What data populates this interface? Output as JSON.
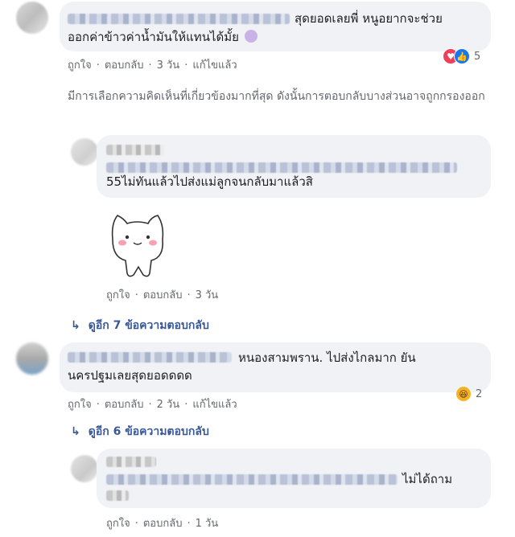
{
  "comments": [
    {
      "text_line1": "สุดยอดเลยพี่ หนูอยากจะช่วย",
      "text_line2": "ออกค่าข้าวค่าน้ำมันให้แทนได้มั้ย",
      "actions": {
        "like": "ถูกใจ",
        "reply": "ตอบกลับ",
        "time": "3 วัน",
        "edited": "แก้ไขแล้ว"
      },
      "reaction_count": "5",
      "notice": "มีการเลือกความคิดเห็นที่เกี่ยวข้องมากที่สุด ดังนั้นการตอบกลับบางส่วนอาจถูกกรองออก"
    },
    {
      "text": "55ไม่ทันแล้วไปส่งแม่ลูกจนกลับมาแล้วสิ",
      "actions": {
        "like": "ถูกใจ",
        "reply": "ตอบกลับ",
        "time": "3 วัน"
      },
      "more_replies": "ดูอีก 7 ข้อความตอบกลับ"
    },
    {
      "text_line1": "หนองสามพราน. ไปส่งไกลมาก ยัน",
      "text_line2": "นครปฐมเลยสุดยอดดดด",
      "actions": {
        "like": "ถูกใจ",
        "reply": "ตอบกลับ",
        "time": "2 วัน",
        "edited": "แก้ไขแล้ว"
      },
      "reaction_count": "2",
      "more_replies": "ดูอีก 6 ข้อความตอบกลับ"
    },
    {
      "text": "ไม่ได้ถาม",
      "actions": {
        "like": "ถูกใจ",
        "reply": "ตอบกลับ",
        "time": "1 วัน"
      }
    }
  ],
  "colors": {
    "link": "#385898",
    "muted": "#65676b",
    "bubble": "#f0f2f5",
    "love": "#f33e58",
    "like": "#1877f2",
    "haha": "#f7b125"
  },
  "icons": [
    "love-reaction-icon",
    "like-reaction-icon",
    "haha-reaction-icon",
    "reply-arrow-icon",
    "cat-sticker"
  ]
}
